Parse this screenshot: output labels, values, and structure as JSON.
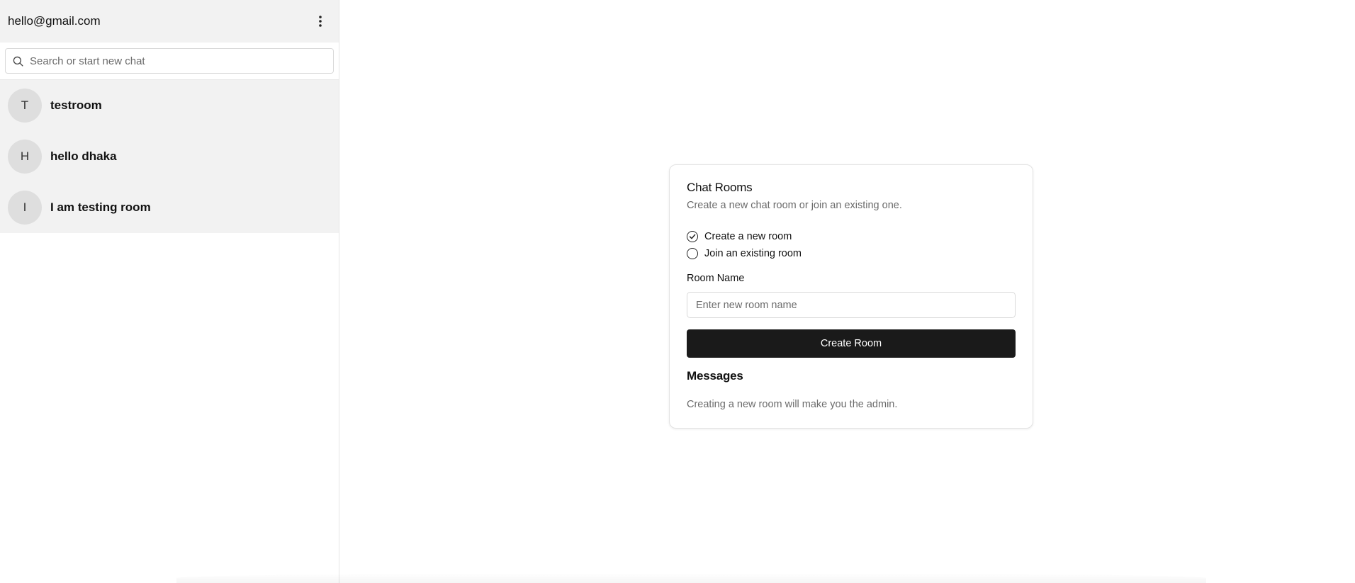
{
  "sidebar": {
    "user_email": "hello@gmail.com",
    "menu_icon": "more-vertical-icon",
    "search": {
      "icon": "search-icon",
      "placeholder": "Search or start new chat",
      "value": ""
    },
    "rooms": [
      {
        "initial": "T",
        "name": "testroom"
      },
      {
        "initial": "H",
        "name": "hello dhaka"
      },
      {
        "initial": "I",
        "name": "I am testing room"
      }
    ]
  },
  "main": {
    "card": {
      "title": "Chat Rooms",
      "subtitle": "Create a new chat room or join an existing one.",
      "options": [
        {
          "label": "Create a new room",
          "selected": true
        },
        {
          "label": "Join an existing room",
          "selected": false
        }
      ],
      "room_name_label": "Room Name",
      "room_name_placeholder": "Enter new room name",
      "room_name_value": "",
      "create_button_label": "Create Room",
      "messages_title": "Messages",
      "messages_text": "Creating a new room will make you the admin."
    }
  },
  "colors": {
    "sidebar_header_bg": "#f2f2f2",
    "room_list_bg": "#f2f2f2",
    "avatar_bg": "#dedede",
    "primary_button_bg": "#1a1a1a",
    "muted_text": "#6b6b6b"
  }
}
